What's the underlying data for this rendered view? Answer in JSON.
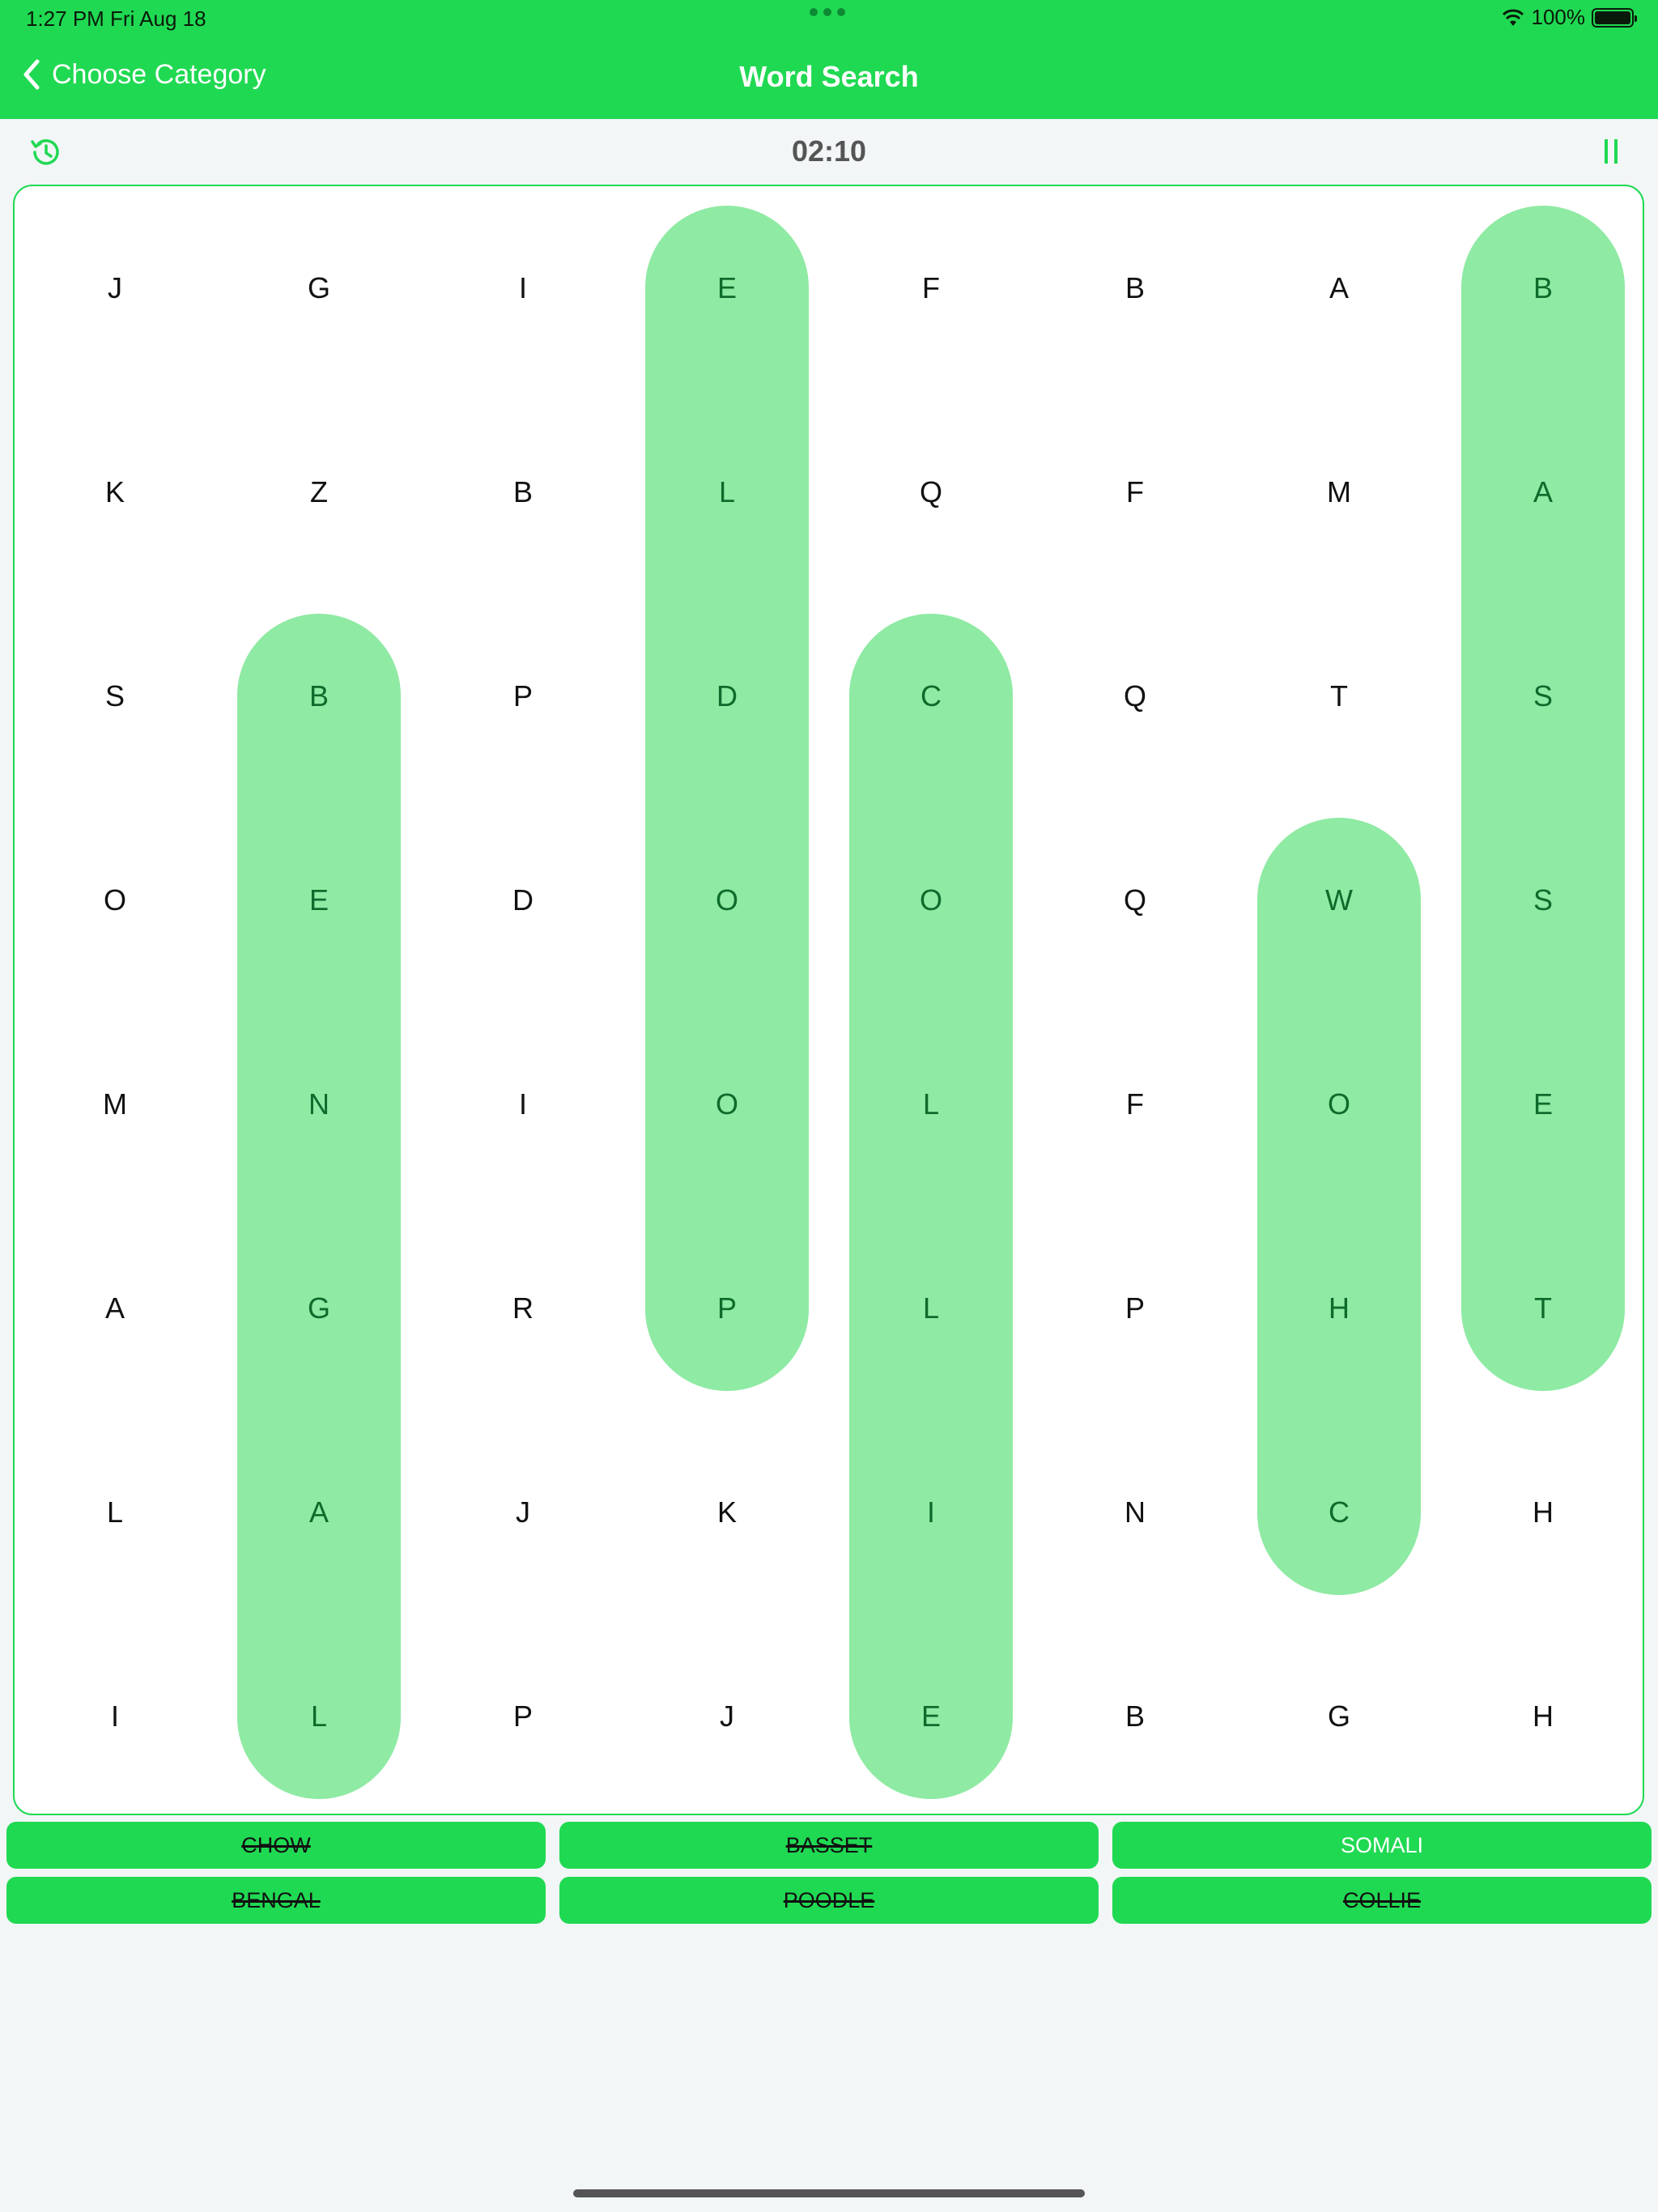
{
  "status_bar": {
    "time": "1:27 PM   Fri Aug 18",
    "battery": "100%"
  },
  "nav": {
    "back_label": "Choose Category",
    "title": "Word Search"
  },
  "timer": "02:10",
  "grid": [
    [
      "J",
      "G",
      "I",
      "E",
      "F",
      "B",
      "A",
      "B"
    ],
    [
      "K",
      "Z",
      "B",
      "L",
      "Q",
      "F",
      "M",
      "A"
    ],
    [
      "S",
      "B",
      "P",
      "D",
      "C",
      "Q",
      "T",
      "S"
    ],
    [
      "O",
      "E",
      "D",
      "O",
      "O",
      "Q",
      "W",
      "S"
    ],
    [
      "M",
      "N",
      "I",
      "O",
      "L",
      "F",
      "O",
      "E"
    ],
    [
      "A",
      "G",
      "R",
      "P",
      "L",
      "P",
      "H",
      "T"
    ],
    [
      "L",
      "A",
      "J",
      "K",
      "I",
      "N",
      "C",
      "H"
    ],
    [
      "I",
      "L",
      "P",
      "J",
      "E",
      "B",
      "G",
      "H"
    ]
  ],
  "found_words": [
    {
      "word": "ELDOOP",
      "col": 3,
      "row_start": 0,
      "row_end": 5
    },
    {
      "word": "BASSET",
      "col": 7,
      "row_start": 0,
      "row_end": 5
    },
    {
      "word": "BENGAL",
      "col": 1,
      "row_start": 2,
      "row_end": 7
    },
    {
      "word": "COLLIE",
      "col": 4,
      "row_start": 2,
      "row_end": 7
    },
    {
      "word": "WOHC",
      "col": 6,
      "row_start": 3,
      "row_end": 6
    }
  ],
  "words": [
    {
      "label": "CHOW",
      "found": true
    },
    {
      "label": "BASSET",
      "found": true
    },
    {
      "label": "SOMALI",
      "found": false
    },
    {
      "label": "BENGAL",
      "found": true
    },
    {
      "label": "POODLE",
      "found": true
    },
    {
      "label": "COLLIE",
      "found": true
    }
  ],
  "colors": {
    "accent": "#20d952",
    "highlight": "#8feaa3",
    "found_text": "#0d6b2c"
  }
}
